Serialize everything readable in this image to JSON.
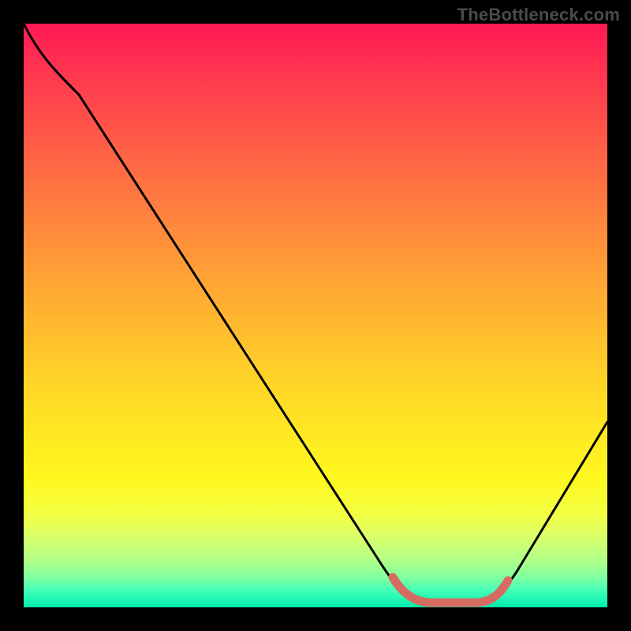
{
  "watermark": "TheBottleneck.com",
  "chart_data": {
    "type": "line",
    "title": "",
    "xlabel": "",
    "ylabel": "",
    "xlim": [
      0,
      100
    ],
    "ylim": [
      0,
      100
    ],
    "legend": false,
    "grid": false,
    "background_gradient": {
      "top": "#ff1a55",
      "mid": "#ffe822",
      "bottom": "#00e8a6",
      "meaning": "red = high bottleneck, green = low bottleneck"
    },
    "series": [
      {
        "name": "bottleneck-curve",
        "color": "#000000",
        "x": [
          0,
          4,
          10,
          20,
          30,
          40,
          50,
          60,
          64,
          68,
          72,
          76,
          80,
          84,
          88,
          92,
          96,
          100
        ],
        "values": [
          100,
          96,
          90,
          78,
          66,
          53,
          40,
          25,
          15,
          4,
          1,
          1,
          2,
          4,
          10,
          18,
          26,
          34
        ]
      },
      {
        "name": "optimal-zone-marker",
        "color": "#d66b62",
        "x": [
          64,
          66,
          68,
          70,
          72,
          74,
          76,
          78,
          80,
          82
        ],
        "values": [
          5,
          3,
          2,
          1,
          1,
          1,
          1,
          2,
          3,
          5
        ]
      }
    ],
    "annotations": []
  }
}
